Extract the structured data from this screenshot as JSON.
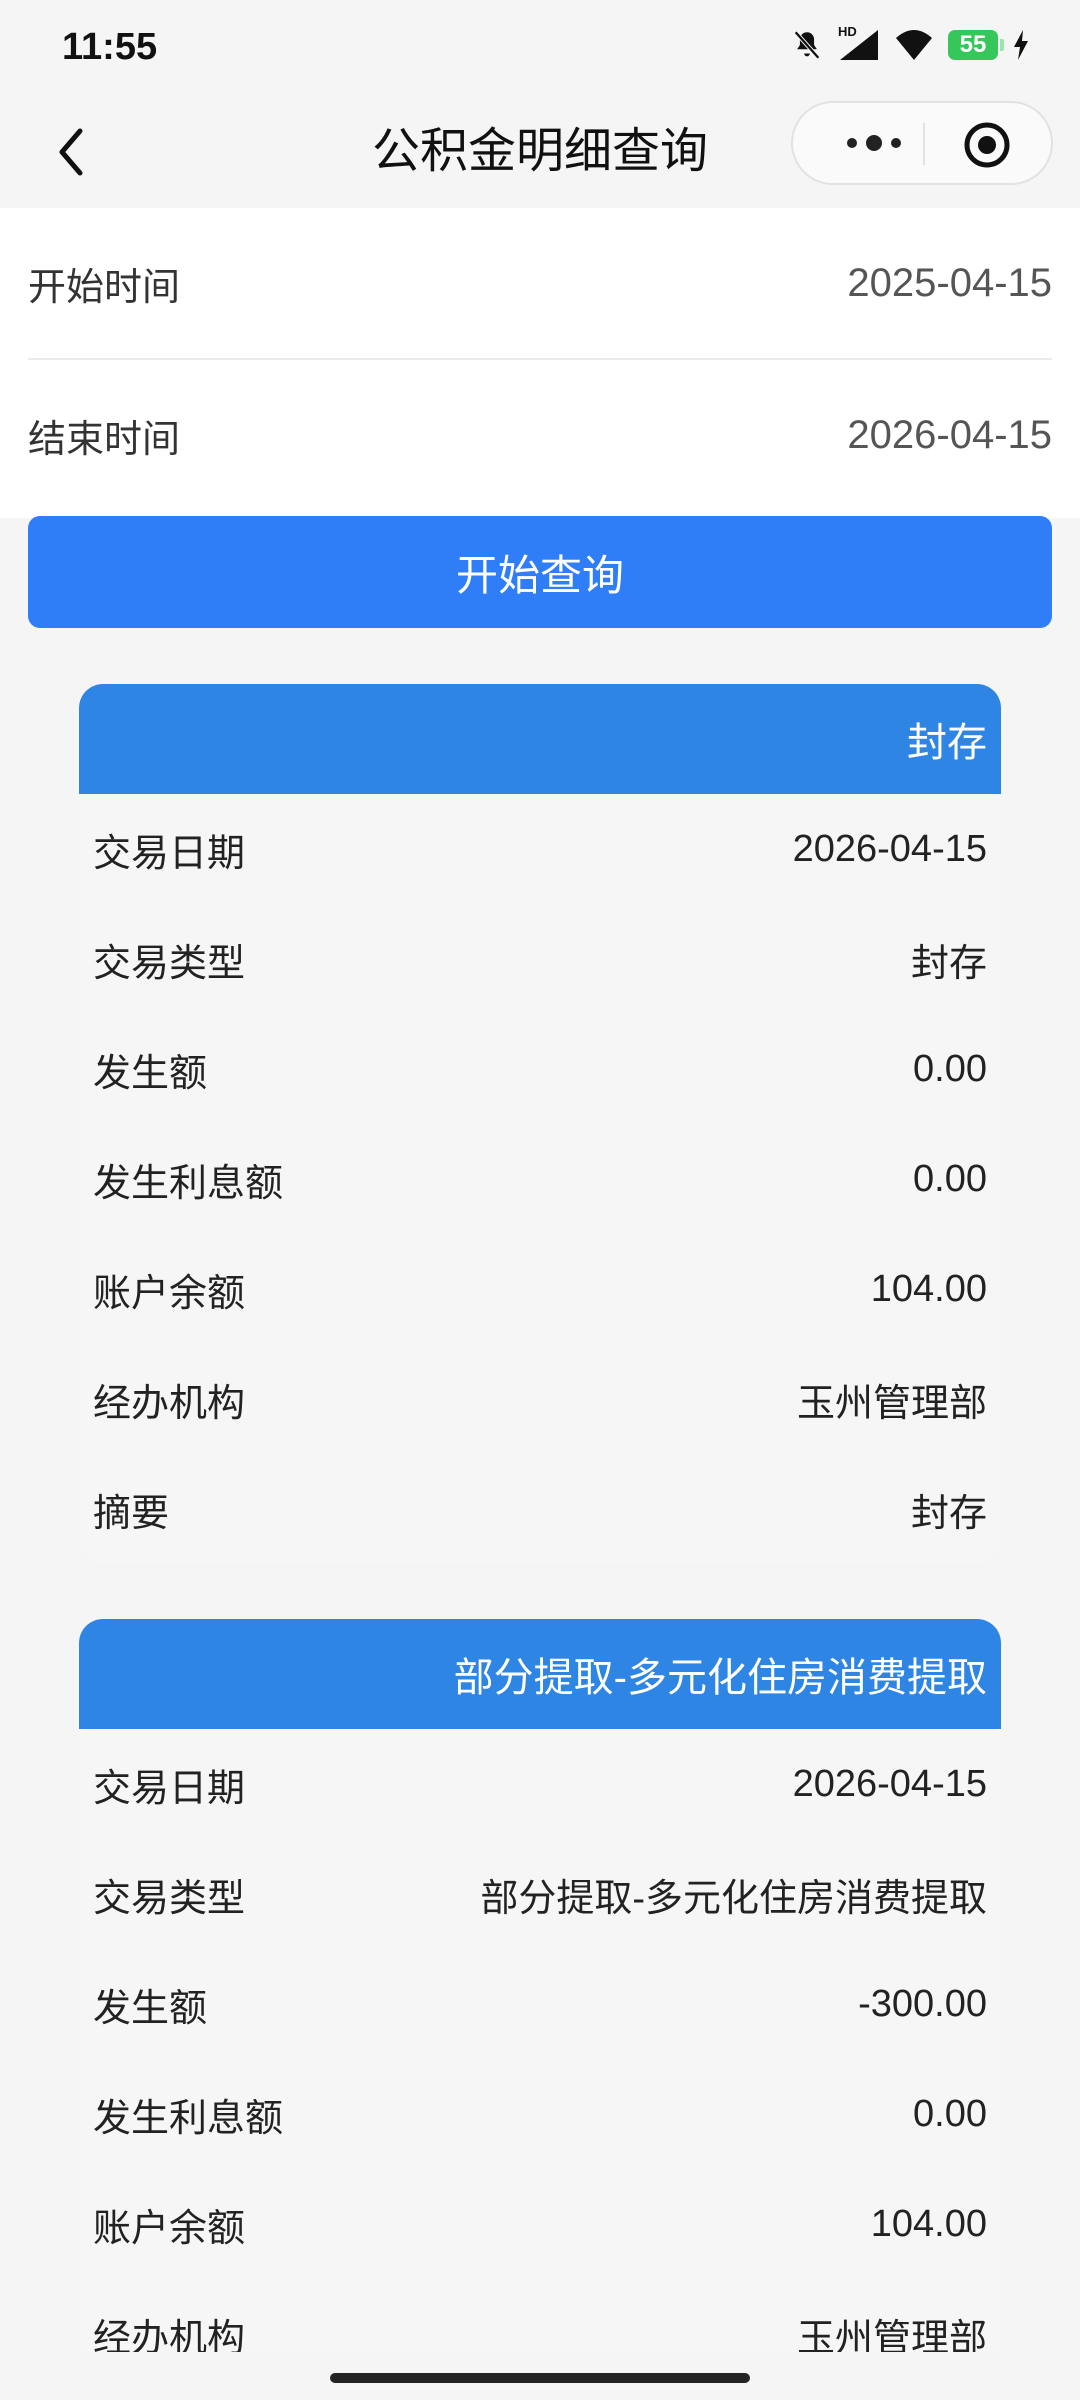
{
  "status_bar": {
    "time": "11:55",
    "battery": "55",
    "network": "HD"
  },
  "nav": {
    "title": "公积金明细查询"
  },
  "form": {
    "start_label": "开始时间",
    "start_value": "2025-04-15",
    "end_label": "结束时间",
    "end_value": "2026-04-15",
    "query_button": "开始查询"
  },
  "records": [
    {
      "header": "封存",
      "rows": [
        {
          "label": "交易日期",
          "value": "2026-04-15"
        },
        {
          "label": "交易类型",
          "value": "封存"
        },
        {
          "label": "发生额",
          "value": "0.00"
        },
        {
          "label": "发生利息额",
          "value": "0.00"
        },
        {
          "label": "账户余额",
          "value": "104.00"
        },
        {
          "label": "经办机构",
          "value": "玉州管理部"
        },
        {
          "label": "摘要",
          "value": "封存"
        }
      ]
    },
    {
      "header": "部分提取-多元化住房消费提取",
      "rows": [
        {
          "label": "交易日期",
          "value": "2026-04-15"
        },
        {
          "label": "交易类型",
          "value": "部分提取-多元化住房消费提取"
        },
        {
          "label": "发生额",
          "value": "-300.00"
        },
        {
          "label": "发生利息额",
          "value": "0.00"
        },
        {
          "label": "账户余额",
          "value": "104.00"
        },
        {
          "label": "经办机构",
          "value": "玉州管理部"
        }
      ]
    }
  ],
  "colors": {
    "primary_button": "#2f7ef7",
    "card_header": "#2f85e4",
    "battery": "#35c759"
  }
}
